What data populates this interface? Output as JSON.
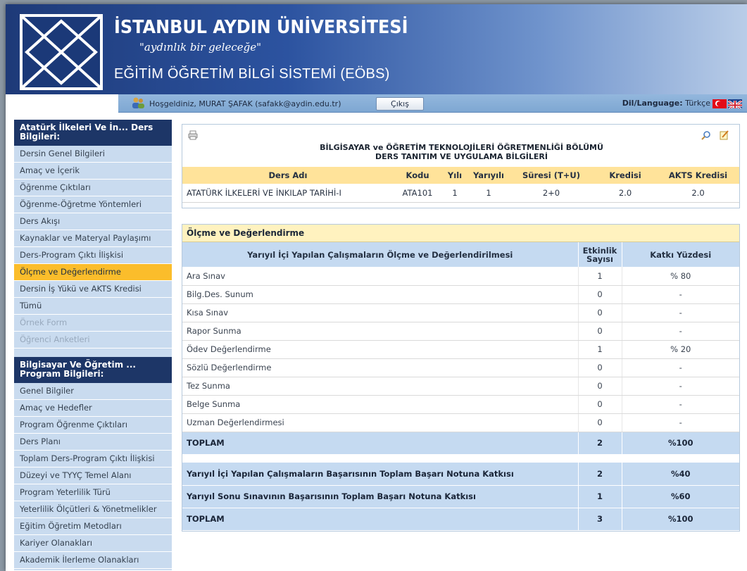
{
  "header": {
    "university_name": "İSTANBUL AYDIN ÜNİVERSİTESİ",
    "motto": "\"aydınlık bir geleceğe\"",
    "system_title": "EĞİTİM ÖĞRETİM BİLGİ SİSTEMİ (EÖBS)"
  },
  "userbar": {
    "welcome": "Hoşgeldiniz, MURAT ŞAFAK  (safakk@aydin.edu.tr)",
    "logout_label": "Çıkış",
    "language_label": "Dil/Language:",
    "language_value": "Türkçe"
  },
  "sidebar": {
    "course_section_title": "Atatürk İlkeleri Ve İn... Ders Bilgileri:",
    "course_items": [
      {
        "label": "Dersin Genel Bilgileri"
      },
      {
        "label": "Amaç ve İçerik"
      },
      {
        "label": "Öğrenme Çıktıları"
      },
      {
        "label": "Öğrenme-Öğretme Yöntemleri"
      },
      {
        "label": "Ders Akışı"
      },
      {
        "label": "Kaynaklar ve Materyal Paylaşımı"
      },
      {
        "label": "Ders-Program Çıktı İlişkisi"
      },
      {
        "label": "Ölçme ve Değerlendirme"
      },
      {
        "label": "Dersin İş Yükü ve AKTS Kredisi"
      },
      {
        "label": "Tümü"
      },
      {
        "label": "Örnek Form"
      },
      {
        "label": "Öğrenci Anketleri"
      }
    ],
    "program_section_title": "Bilgisayar Ve Öğretim ... Program Bilgileri:",
    "program_items": [
      {
        "label": "Genel Bilgiler"
      },
      {
        "label": "Amaç ve Hedefler"
      },
      {
        "label": "Program Öğrenme Çıktıları"
      },
      {
        "label": "Ders Planı"
      },
      {
        "label": "Toplam Ders-Program Çıktı İlişkisi"
      },
      {
        "label": "Düzeyi ve TYYÇ Temel Alanı"
      },
      {
        "label": "Program Yeterlilik Türü"
      },
      {
        "label": "Yeterlilik Ölçütleri & Yönetmelikler"
      },
      {
        "label": "Eğitim Öğretim Metodları"
      },
      {
        "label": "Kariyer Olanakları"
      },
      {
        "label": "Akademik İlerleme Olanakları"
      }
    ]
  },
  "course": {
    "department_title": "BİLGİSAYAR ve ÖĞRETİM TEKNOLOJİLERİ ÖĞRETMENLİĞİ BÖLÜMÜ",
    "subtitle": "DERS TANITIM VE UYGULAMA BİLGİLERİ",
    "headers": [
      "Ders Adı",
      "Kodu",
      "Yılı",
      "Yarıyılı",
      "Süresi (T+U)",
      "Kredisi",
      "AKTS Kredisi"
    ],
    "row": [
      "ATATÜRK İLKELERİ VE İNKILAP TARİHİ-I",
      "ATA101",
      "1",
      "1",
      "2+0",
      "2.0",
      "2.0"
    ]
  },
  "evaluation": {
    "title": "Ölçme ve Değerlendirme",
    "headers": {
      "activity": "Yarıyıl İçi Yapılan Çalışmaların Ölçme ve Değerlendirilmesi",
      "count": "Etkinlik Sayısı",
      "percent": "Katkı Yüzdesi"
    },
    "rows": [
      {
        "name": "Ara Sınav",
        "count": "1",
        "percent": "% 80"
      },
      {
        "name": "Bilg.Des. Sunum",
        "count": "0",
        "percent": "-"
      },
      {
        "name": "Kısa Sınav",
        "count": "0",
        "percent": "-"
      },
      {
        "name": "Rapor Sunma",
        "count": "0",
        "percent": "-"
      },
      {
        "name": "Ödev Değerlendirme",
        "count": "1",
        "percent": "% 20"
      },
      {
        "name": "Sözlü Değerlendirme",
        "count": "0",
        "percent": "-"
      },
      {
        "name": "Tez Sunma",
        "count": "0",
        "percent": "-"
      },
      {
        "name": "Belge Sunma",
        "count": "0",
        "percent": "-"
      },
      {
        "name": "Uzman Değerlendirmesi",
        "count": "0",
        "percent": "-"
      }
    ],
    "total": {
      "name": "TOPLAM",
      "count": "2",
      "percent": "%100"
    },
    "summary": [
      {
        "name": "Yarıyıl İçi Yapılan Çalışmaların Başarısının Toplam Başarı Notuna Katkısı",
        "count": "2",
        "percent": "%40"
      },
      {
        "name": "Yarıyıl Sonu Sınavının Başarısının Toplam Başarı Notuna Katkısı",
        "count": "1",
        "percent": "%60"
      },
      {
        "name": "TOPLAM",
        "count": "3",
        "percent": "%100"
      }
    ]
  }
}
